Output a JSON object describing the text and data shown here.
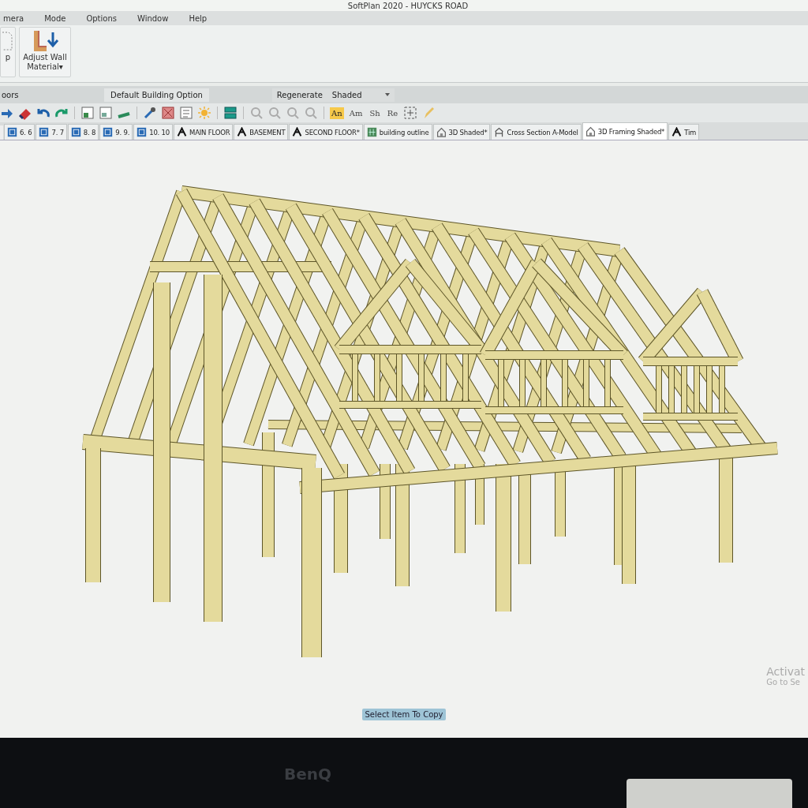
{
  "window": {
    "title": "SoftPlan 2020 - HUYCKS ROAD"
  },
  "menu": [
    {
      "label": "mera"
    },
    {
      "label": "Mode"
    },
    {
      "label": "Options"
    },
    {
      "label": "Window"
    },
    {
      "label": "Help"
    }
  ],
  "ribbon": {
    "buttons": [
      {
        "label": "p",
        "kind": "partial"
      },
      {
        "label": "Adjust Wall Material▾",
        "kind": "wall"
      }
    ]
  },
  "toolbar_labels": {
    "left": "oors",
    "option": "Default Building Option",
    "regenerate": "Regenerate",
    "render_mode": "Shaded"
  },
  "display_toggles": [
    {
      "label": "An",
      "selected": true
    },
    {
      "label": "Am",
      "selected": false
    },
    {
      "label": "Sh",
      "selected": false
    },
    {
      "label": "Re",
      "selected": false
    }
  ],
  "tabs": [
    {
      "label": "6. 6",
      "kind": "floor",
      "selected": false
    },
    {
      "label": "7. 7",
      "kind": "floor",
      "selected": false
    },
    {
      "label": "8. 8",
      "kind": "floor",
      "selected": false
    },
    {
      "label": "9. 9.",
      "kind": "floor",
      "selected": false
    },
    {
      "label": "10. 10",
      "kind": "floor",
      "selected": false
    },
    {
      "label": "MAIN FLOOR",
      "kind": "plan",
      "selected": false
    },
    {
      "label": "BASEMENT",
      "kind": "plan",
      "selected": false
    },
    {
      "label": "SECOND FLOOR*",
      "kind": "plan",
      "selected": false
    },
    {
      "label": "building outline",
      "kind": "outline",
      "selected": false
    },
    {
      "label": "3D Shaded*",
      "kind": "house",
      "selected": false
    },
    {
      "label": "Cross Section A-Model",
      "kind": "section",
      "selected": false
    },
    {
      "label": "3D Framing Shaded*",
      "kind": "house",
      "selected": true
    },
    {
      "label": "Tim",
      "kind": "plan",
      "selected": false
    }
  ],
  "canvas": {
    "activation_title": "Activat",
    "activation_hint": "Go to Se",
    "status_prompt": "Select Item To Copy"
  },
  "monitor": {
    "brand": "BenQ"
  }
}
